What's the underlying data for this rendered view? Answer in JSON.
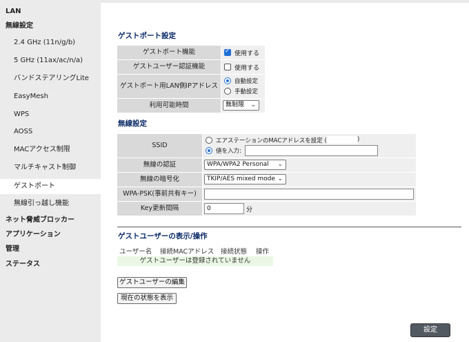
{
  "sidebar": {
    "items": [
      {
        "label": "LAN"
      },
      {
        "label": "無線設定"
      },
      {
        "label": "2.4 GHz (11n/g/b)"
      },
      {
        "label": "5 GHz (11ax/ac/n/a)"
      },
      {
        "label": "バンドステアリングLite"
      },
      {
        "label": "EasyMesh"
      },
      {
        "label": "WPS"
      },
      {
        "label": "AOSS"
      },
      {
        "label": "MACアクセス制限"
      },
      {
        "label": "マルチキャスト制御"
      },
      {
        "label": "ゲストポート"
      },
      {
        "label": "無線引っ越し機能"
      },
      {
        "label": "ネット脅威ブロッカー"
      },
      {
        "label": "アプリケーション"
      },
      {
        "label": "管理"
      },
      {
        "label": "ステータス"
      }
    ],
    "active_item": "ゲストポート"
  },
  "guest_port": {
    "title": "ゲストポート設定",
    "function_label": "ゲストポート機能",
    "function_option": "使用する",
    "function_checked": true,
    "auth_label": "ゲストユーザー認証機能",
    "auth_option": "使用する",
    "auth_checked": false,
    "lan_ip_label": "ゲストポート用LAN側IPアドレス",
    "lan_ip_auto": "自動設定",
    "lan_ip_manual": "手動設定",
    "lan_ip_selected": "自動設定",
    "time_label": "利用可能時間",
    "time_value": "無制限"
  },
  "wireless": {
    "title": "無線設定",
    "ssid_label": "SSID",
    "ssid_opt_mac": "エアステーションのMACアドレスを設定 (",
    "ssid_opt_mac_suffix": ")",
    "ssid_opt_input": "値を入力:",
    "ssid_selected": "値を入力",
    "ssid_value": "",
    "auth_label": "無線の認証",
    "auth_value": "WPA/WPA2 Personal",
    "encryption_label": "無線の暗号化",
    "encryption_value": "TKIP/AES mixed mode",
    "psk_label": "WPA-PSK(事前共有キー)",
    "psk_value": "",
    "key_interval_label": "Key更新間隔",
    "key_interval_value": "0",
    "key_interval_unit": "分"
  },
  "guest_users": {
    "title": "ゲストユーザーの表示/操作",
    "columns": [
      "ユーザー名",
      "接続MACアドレス",
      "接続状態",
      "操作"
    ],
    "empty_message": "ゲストユーザーは登録されていません",
    "edit_button": "ゲストユーザーの編集",
    "status_button": "現在の状態を表示"
  },
  "submit_label": "設定",
  "colors": {
    "accent": "#1f6fd6",
    "title": "#0a2a66",
    "label_bg": "#d9d9d9",
    "value_bg": "#efefef",
    "empty_row_bg": "#eaf7e4",
    "submit_bg": "#535961"
  },
  "icons": {
    "select_chevron": "chevron-down-icon"
  }
}
